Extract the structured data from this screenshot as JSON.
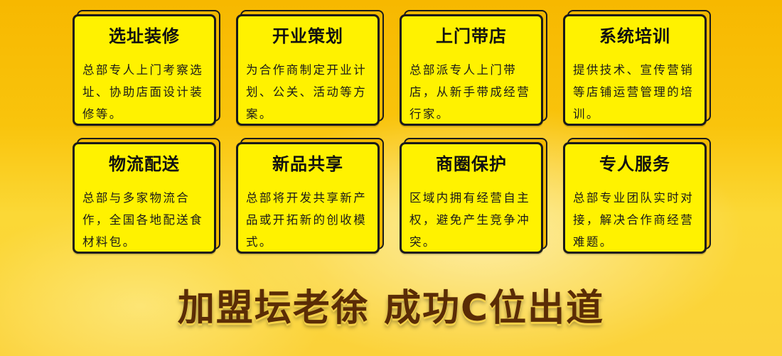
{
  "cards": [
    {
      "title": "选址装修",
      "desc": "总部专人上门考察选址、协助店面设计装修等。"
    },
    {
      "title": "开业策划",
      "desc": "为合作商制定开业计划、公关、活动等方案。"
    },
    {
      "title": "上门带店",
      "desc": "总部派专人上门带店，从新手带成经营行家。"
    },
    {
      "title": "系统培训",
      "desc": "提供技术、宣传营销等店铺运营管理的培训。"
    },
    {
      "title": "物流配送",
      "desc": "总部与多家物流合作，全国各地配送食材料包。"
    },
    {
      "title": "新品共享",
      "desc": "总部将开发共享新产品或开拓新的创收模式。"
    },
    {
      "title": "商圈保护",
      "desc": "区域内拥有经营自主权，避免产生竞争冲突。"
    },
    {
      "title": "专人服务",
      "desc": "总部专业团队实时对接，解决合作商经营难题。"
    }
  ],
  "slogan": "加盟坛老徐 成功C位出道"
}
